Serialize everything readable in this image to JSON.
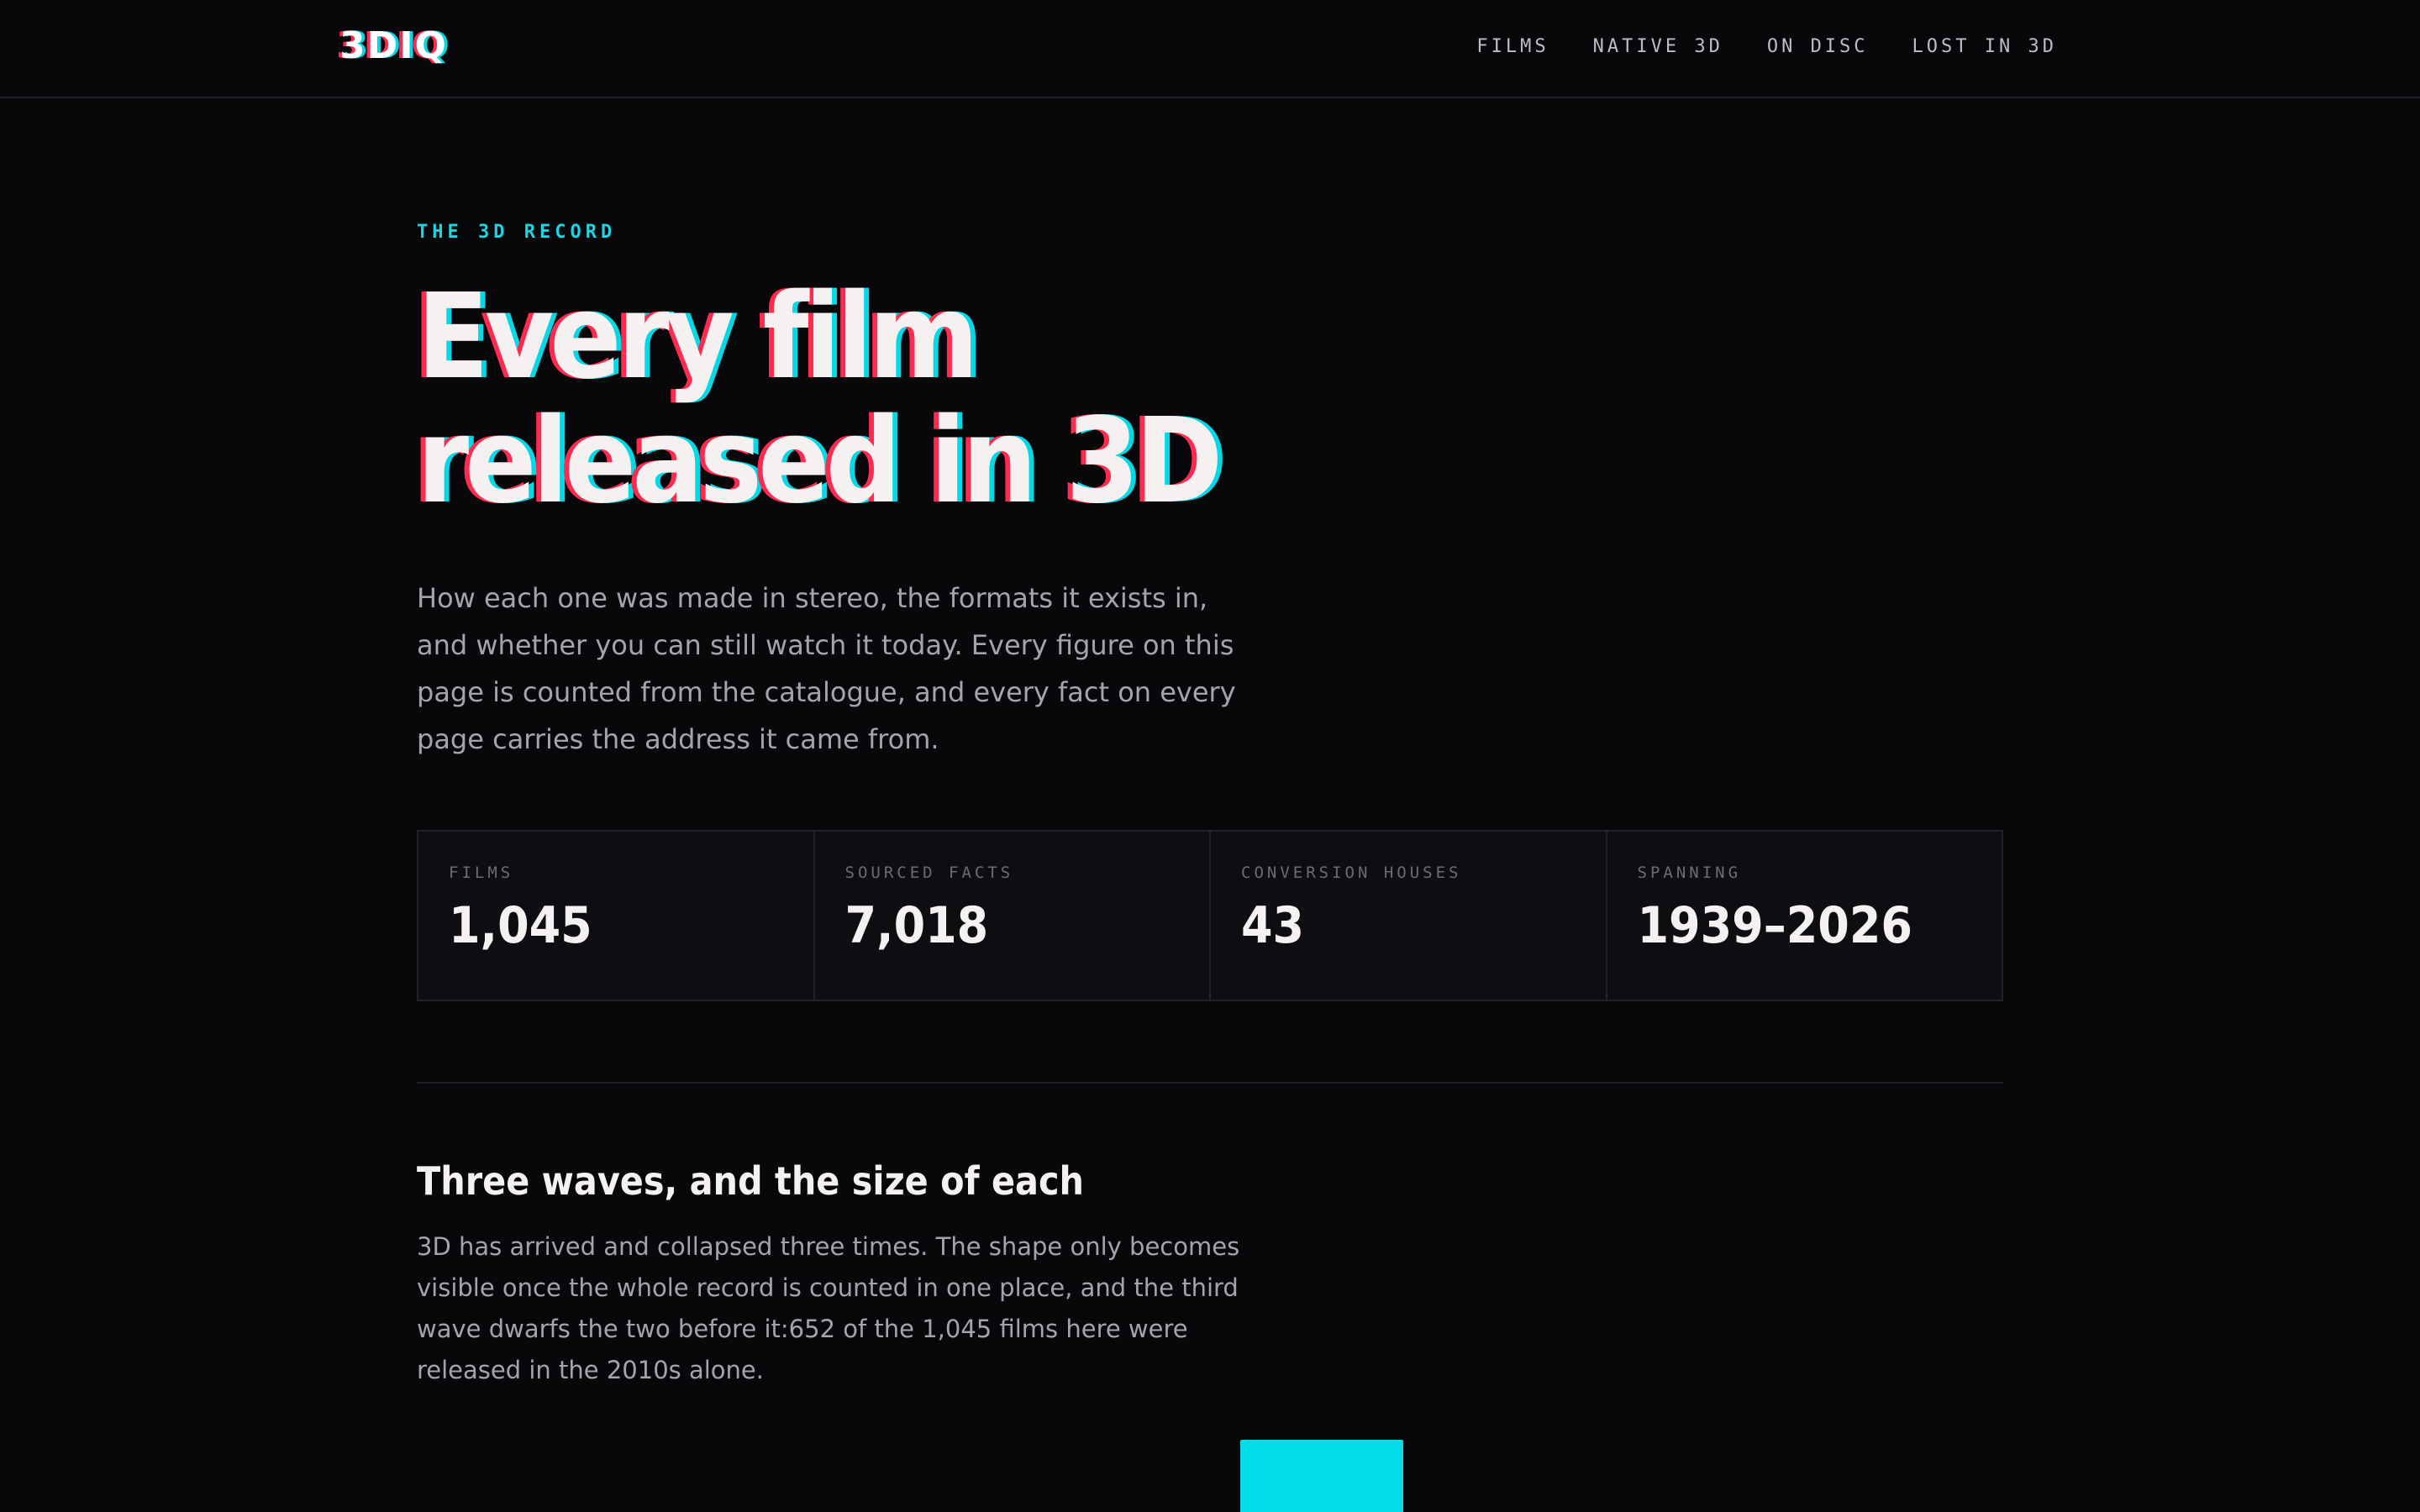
{
  "nav": {
    "logo": "3DIQ",
    "links": [
      "FILMS",
      "NATIVE 3D",
      "ON DISC",
      "LOST IN 3D"
    ]
  },
  "hero": {
    "eyebrow": "THE 3D RECORD",
    "title_line1": "Every film",
    "title_line2": "released in 3D",
    "lede": "How each one was made in stereo, the formats it exists in, and whether you can still watch it today. Every figure on this page is counted from the catalogue, and every fact on every page carries the address it came from."
  },
  "stats": [
    {
      "label": "FILMS",
      "value": "1,045"
    },
    {
      "label": "SOURCED FACTS",
      "value": "7,018"
    },
    {
      "label": "CONVERSION HOUSES",
      "value": "43"
    },
    {
      "label": "SPANNING",
      "value": "1939–2026"
    }
  ],
  "waves": {
    "title": "Three waves, and the size of each",
    "body": "3D has arrived and collapsed three times. The shape only becomes visible once the whole record is counted in one place, and the third wave dwarfs the two before it:652 of the 1,045 films here were released in the 2010s alone."
  },
  "colors": {
    "accent_cyan": "#00dde6",
    "accent_red": "#ff2a4f",
    "background": "#08080a"
  }
}
